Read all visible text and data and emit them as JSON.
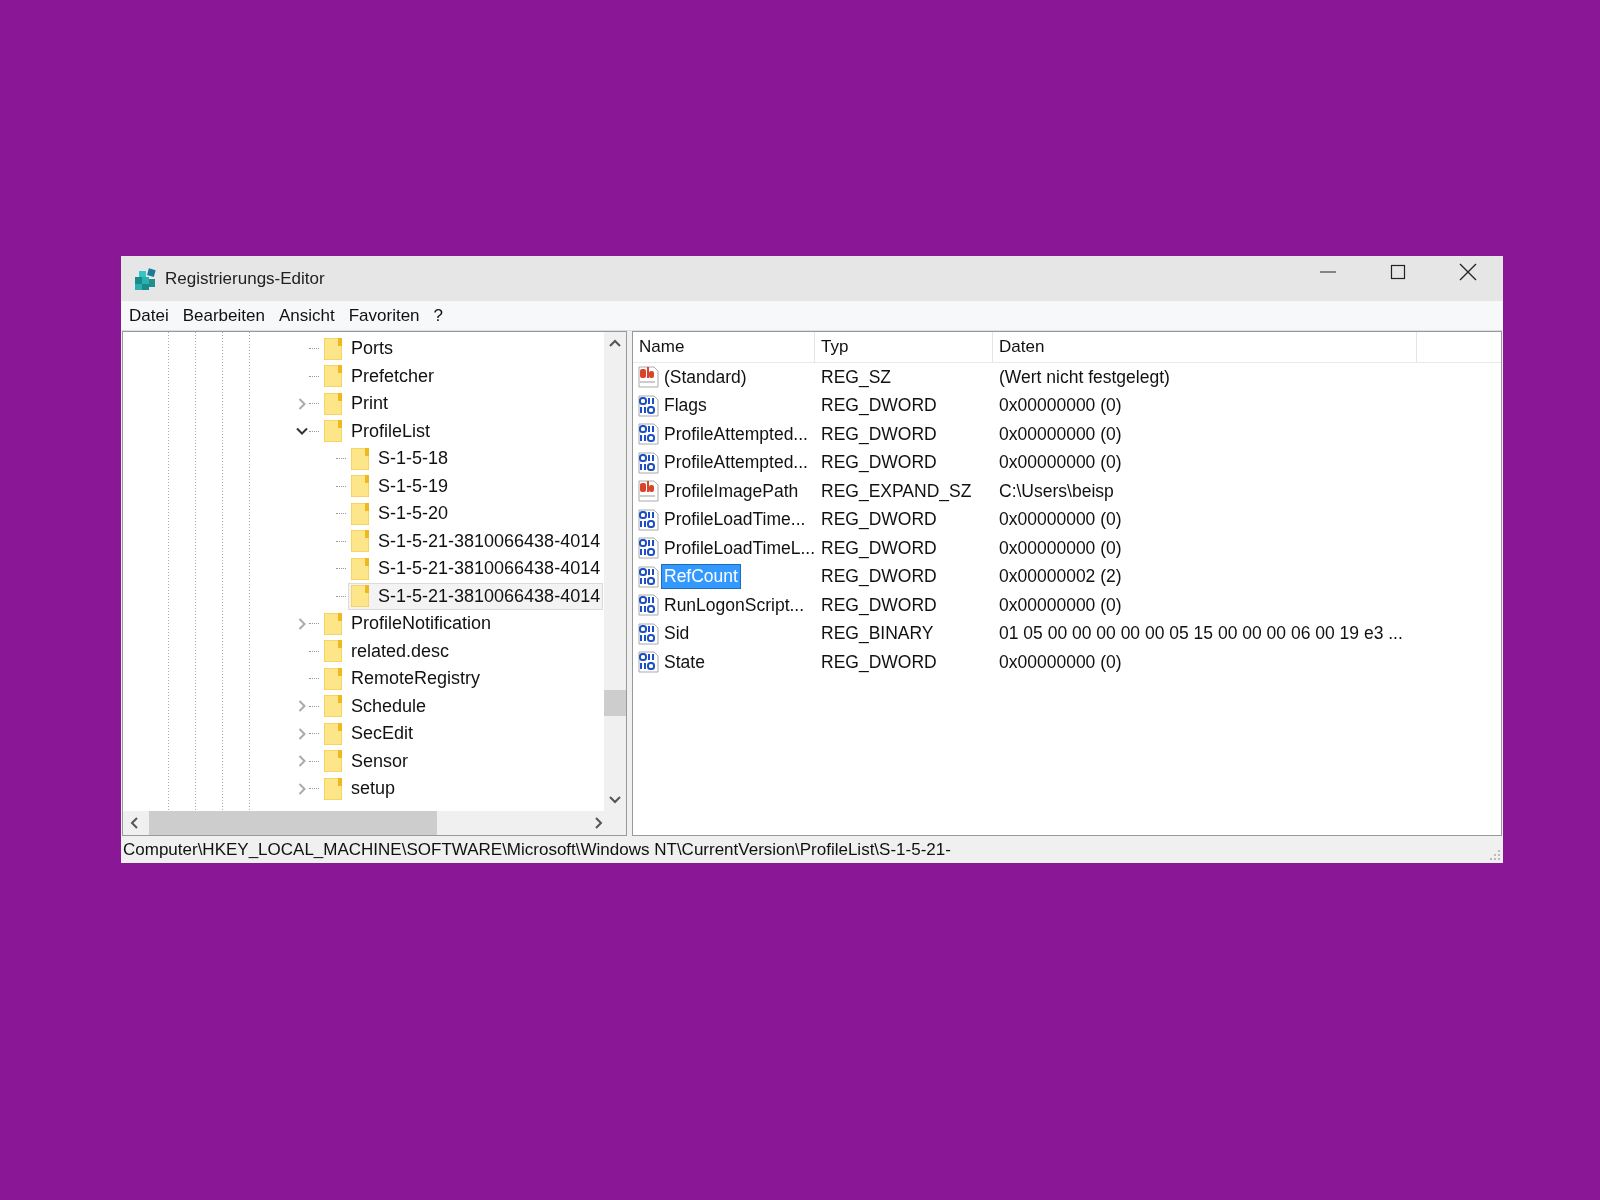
{
  "window": {
    "title": "Registrierungs-Editor"
  },
  "menu": [
    "Datei",
    "Bearbeiten",
    "Ansicht",
    "Favoriten",
    "?"
  ],
  "tree": {
    "items": [
      {
        "label": "Ports",
        "selected": false
      },
      {
        "label": "Prefetcher",
        "selected": false
      },
      {
        "label": "Print",
        "expanded": false,
        "selected": false
      },
      {
        "label": "ProfileList",
        "expanded": true,
        "selected": false,
        "children": [
          {
            "label": "S-1-5-18",
            "selected": false
          },
          {
            "label": "S-1-5-19",
            "selected": false
          },
          {
            "label": "S-1-5-20",
            "selected": false
          },
          {
            "label": "S-1-5-21-3810066438-4014",
            "selected": false
          },
          {
            "label": "S-1-5-21-3810066438-4014",
            "selected": false
          },
          {
            "label": "S-1-5-21-3810066438-4014",
            "selected": true
          }
        ]
      },
      {
        "label": "ProfileNotification",
        "expanded": false,
        "selected": false
      },
      {
        "label": "related.desc",
        "selected": false
      },
      {
        "label": "RemoteRegistry",
        "selected": false
      },
      {
        "label": "Schedule",
        "expanded": false,
        "selected": false
      },
      {
        "label": "SecEdit",
        "expanded": false,
        "selected": false
      },
      {
        "label": "Sensor",
        "expanded": false,
        "selected": false
      },
      {
        "label": "setup",
        "expanded": false,
        "selected": false
      }
    ]
  },
  "values": {
    "columns": [
      "Name",
      "Typ",
      "Daten"
    ],
    "rows": [
      {
        "kind": "string",
        "name": "(Standard)",
        "type": "REG_SZ",
        "data": "(Wert nicht festgelegt)",
        "selected": false
      },
      {
        "kind": "binary",
        "name": "Flags",
        "type": "REG_DWORD",
        "data": "0x00000000 (0)",
        "selected": false
      },
      {
        "kind": "binary",
        "name": "ProfileAttempted...",
        "type": "REG_DWORD",
        "data": "0x00000000 (0)",
        "selected": false
      },
      {
        "kind": "binary",
        "name": "ProfileAttempted...",
        "type": "REG_DWORD",
        "data": "0x00000000 (0)",
        "selected": false
      },
      {
        "kind": "string",
        "name": "ProfileImagePath",
        "type": "REG_EXPAND_SZ",
        "data": "C:\\Users\\beisp",
        "selected": false
      },
      {
        "kind": "binary",
        "name": "ProfileLoadTime...",
        "type": "REG_DWORD",
        "data": "0x00000000 (0)",
        "selected": false
      },
      {
        "kind": "binary",
        "name": "ProfileLoadTimeL...",
        "type": "REG_DWORD",
        "data": "0x00000000 (0)",
        "selected": false
      },
      {
        "kind": "binary",
        "name": "RefCount",
        "type": "REG_DWORD",
        "data": "0x00000002 (2)",
        "selected": true
      },
      {
        "kind": "binary",
        "name": "RunLogonScript...",
        "type": "REG_DWORD",
        "data": "0x00000000 (0)",
        "selected": false
      },
      {
        "kind": "binary",
        "name": "Sid",
        "type": "REG_BINARY",
        "data": "01 05 00 00 00 00 00 05 15 00 00 00 06 00 19 e3 ...",
        "selected": false
      },
      {
        "kind": "binary",
        "name": "State",
        "type": "REG_DWORD",
        "data": "0x00000000 (0)",
        "selected": false
      }
    ]
  },
  "status_bar": "Computer\\HKEY_LOCAL_MACHINE\\SOFTWARE\\Microsoft\\Windows NT\\CurrentVersion\\ProfileList\\S-1-5-21-"
}
